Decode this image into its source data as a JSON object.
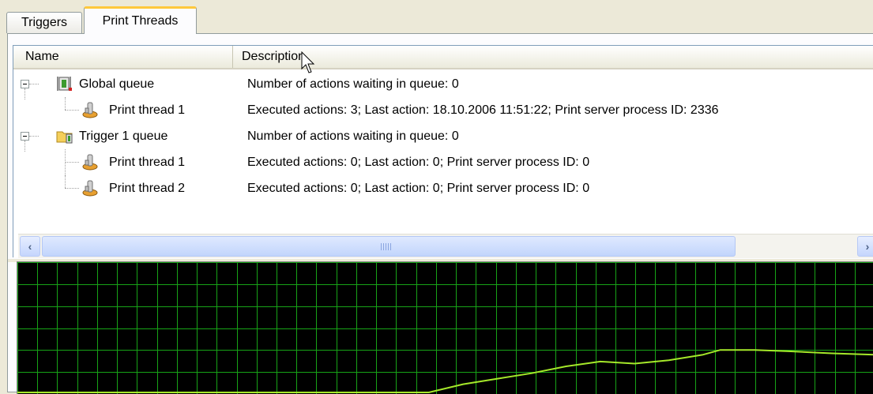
{
  "tabs": [
    {
      "label": "Triggers",
      "active": false
    },
    {
      "label": "Print Threads",
      "active": true
    }
  ],
  "columns": {
    "name": "Name",
    "description": "Description"
  },
  "rows": [
    {
      "name": "Global queue",
      "description": "Number of actions waiting in queue: 0",
      "level": 0,
      "icon": "queue-icon"
    },
    {
      "name": "Print thread 1",
      "description": "Executed actions: 3;  Last action: 18.10.2006 11:51:22;  Print server process ID: 2336",
      "level": 1,
      "icon": "print-thread-icon"
    },
    {
      "name": "Trigger 1 queue",
      "description": "Number of actions waiting in queue: 0",
      "level": 0,
      "icon": "folder-queue-icon"
    },
    {
      "name": "Print thread 1",
      "description": "Executed actions: 0;  Last action: 0;  Print server process ID: 0",
      "level": 1,
      "icon": "print-thread-icon"
    },
    {
      "name": "Print thread 2",
      "description": "Executed actions: 0;  Last action: 0;  Print server process ID: 0",
      "level": 1,
      "icon": "print-thread-icon"
    }
  ],
  "graph": {
    "background": "#000000",
    "grid_color": "#17a317",
    "line_color": "#a5e82a",
    "grid_columns": 43,
    "grid_rows": 6,
    "series": [
      [
        0.0,
        0.0
      ],
      [
        0.48,
        0.0
      ],
      [
        0.52,
        0.12
      ],
      [
        0.56,
        0.2
      ],
      [
        0.6,
        0.28
      ],
      [
        0.64,
        0.38
      ],
      [
        0.68,
        0.45
      ],
      [
        0.72,
        0.42
      ],
      [
        0.76,
        0.47
      ],
      [
        0.8,
        0.55
      ],
      [
        0.82,
        0.62
      ],
      [
        0.86,
        0.62
      ],
      [
        0.9,
        0.6
      ],
      [
        0.95,
        0.57
      ],
      [
        1.0,
        0.55
      ]
    ]
  },
  "colors": {
    "tab_highlight": "#ffc83c",
    "header_bg": "#ebeadb",
    "scrollbar": "#c5d6fd"
  }
}
